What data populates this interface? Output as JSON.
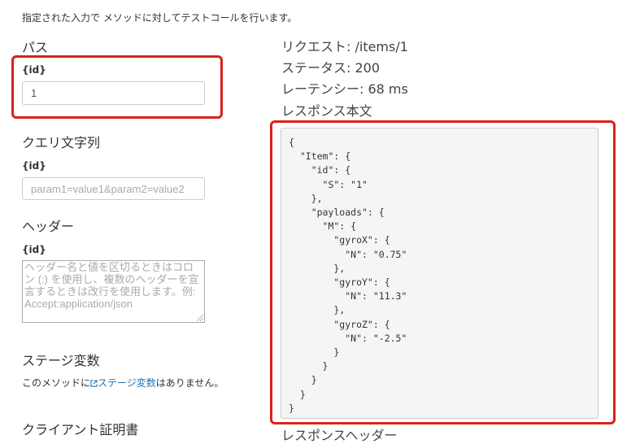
{
  "intro": "指定された入力で メソッドに対してテストコールを行います。",
  "path": {
    "heading": "パス",
    "param_label": "{id}",
    "value": "1"
  },
  "query": {
    "heading": "クエリ文字列",
    "param_label": "{id}",
    "placeholder": "param1=value1&param2=value2"
  },
  "headers": {
    "heading": "ヘッダー",
    "param_label": "{id}",
    "placeholder": "ヘッダー名と値を区切るときはコロン (:) を使用し、複数のヘッダーを宣言するときは改行を使用します。例: Accept:application/json"
  },
  "stage_vars": {
    "heading": "ステージ変数",
    "text_before": "このメソッドに",
    "link_text": "ステージ変数",
    "text_after": "はありません。"
  },
  "client_cert": {
    "heading": "クライアント証明書"
  },
  "response": {
    "request_label": "リクエスト: /items/1",
    "status_label": "ステータス: 200",
    "latency_label": "レーテンシー: 68 ms",
    "body_heading": "レスポンス本文",
    "body": "{\n  \"Item\": {\n    \"id\": {\n      \"S\": \"1\"\n    },\n    \"payloads\": {\n      \"M\": {\n        \"gyroX\": {\n          \"N\": \"0.75\"\n        },\n        \"gyroY\": {\n          \"N\": \"11.3\"\n        },\n        \"gyroZ\": {\n          \"N\": \"-2.5\"\n        }\n      }\n    }\n  }\n}",
    "headers_heading": "レスポンスヘッダー"
  },
  "colors": {
    "highlight": "#d9231b",
    "link": "#1a73b8"
  }
}
